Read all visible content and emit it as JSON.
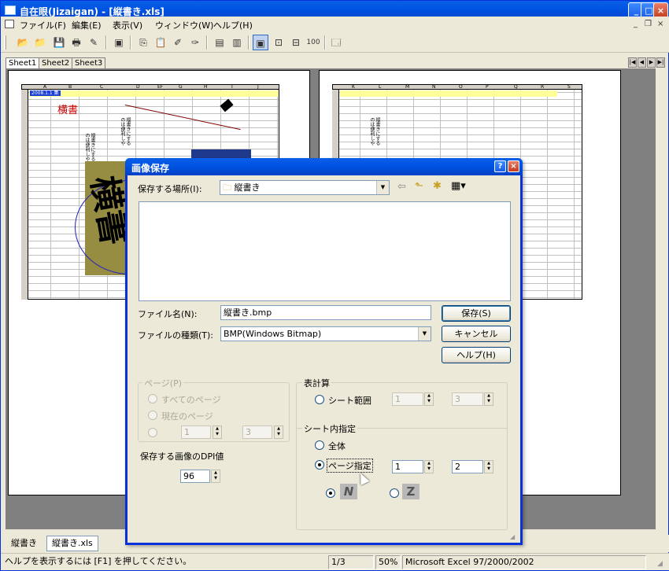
{
  "window": {
    "title": "自在眼(Jizaigan) - [縦書き.xls]",
    "buttons": {
      "minimize": "_",
      "maximize": "□",
      "close": "×"
    },
    "mdi_buttons": {
      "minimize": "_",
      "restore": "❐",
      "close": "×"
    }
  },
  "menu": [
    "ファイル(F)",
    "編集(E)",
    "表示(V)",
    "ウィンドウ(W)",
    "ヘルプ(H)"
  ],
  "toolbar": {
    "zoom_100": "100"
  },
  "sheet_tabs": [
    "Sheet1",
    "Sheet2",
    "Sheet3"
  ],
  "preview": {
    "left_columns": [
      "A",
      "B",
      "C",
      "D",
      "EF",
      "G",
      "H",
      "I",
      "J"
    ],
    "right_columns": [
      "K",
      "L",
      "M",
      "N",
      "O",
      "P",
      "Q",
      "R",
      "S"
    ],
    "rows": [
      "1",
      "2",
      "3",
      "4",
      "5",
      "6",
      "7",
      "8",
      "9",
      "10",
      "11",
      "12",
      "13",
      "14",
      "15",
      "16",
      "17",
      "18",
      "19"
    ],
    "a1_text": "2008.1.1 集",
    "horizontal_label": "横書",
    "big_text": "横書",
    "small_texts": [
      "縦書きにするのは便利しや",
      "縦書きにするのは便利しや",
      "縦書きにするのは便利しや"
    ]
  },
  "doc_tabs": [
    "縦書き",
    "縦書き.xls"
  ],
  "status": {
    "help": "ヘルプを表示するには [F1] を押してください。",
    "page": "1/3",
    "zoom": "50%",
    "format": "Microsoft Excel 97/2000/2002"
  },
  "dialog": {
    "title": "画像保存",
    "help_btn": "?",
    "close_btn": "×",
    "location_label": "保存する場所(I):",
    "location_value": "縦書き",
    "filename_label": "ファイル名(N):",
    "filename_value": "縦書き.bmp",
    "filetype_label": "ファイルの種類(T):",
    "filetype_value": "BMP(Windows Bitmap)",
    "save_button": "保存(S)",
    "cancel_button": "キャンセル",
    "help_button": "ヘルプ(H)",
    "page_group": {
      "title": "ページ(P)",
      "all_pages": "すべてのページ",
      "current_page": "現在のページ",
      "from": "1",
      "to": "3"
    },
    "dpi_label": "保存する画像のDPI値",
    "dpi_value": "96",
    "calc_group": {
      "title": "表計算",
      "sheet_range": "シート範囲",
      "from": "1",
      "to": "3"
    },
    "sheet_group": {
      "title": "シート内指定",
      "whole": "全体",
      "page_spec": "ページ指定",
      "from": "1",
      "to": "2"
    },
    "direction_icons": [
      "N",
      "Z"
    ]
  }
}
